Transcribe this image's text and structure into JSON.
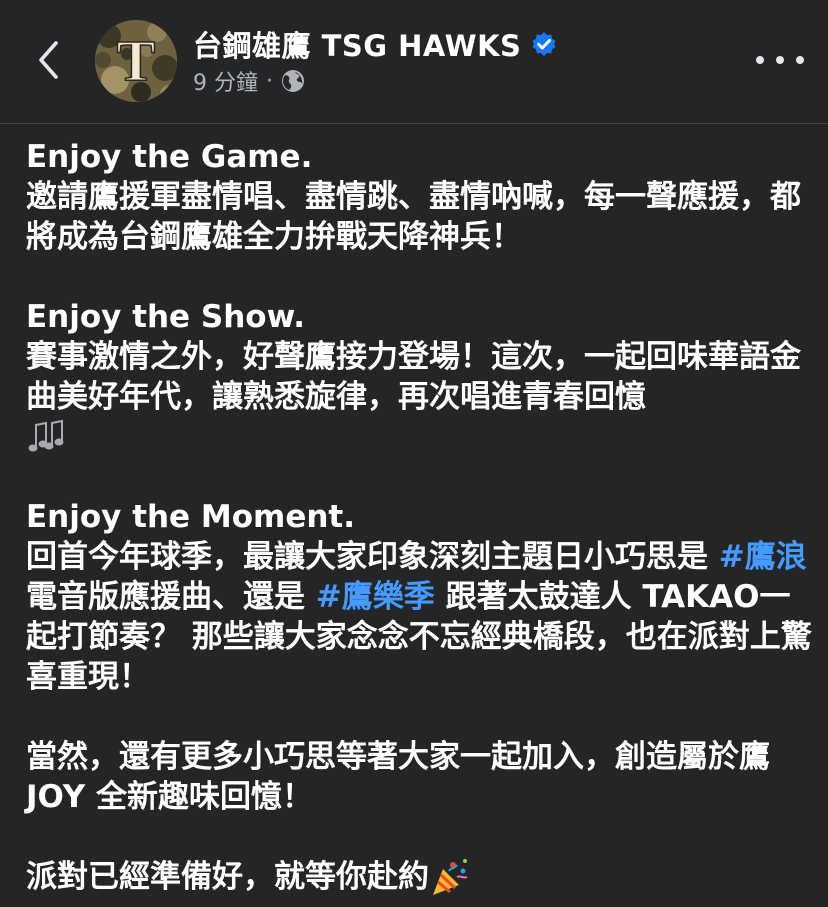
{
  "header": {
    "back_icon": "chevron-left-icon",
    "page_name": "台鋼雄鷹 TSG HAWKS",
    "verified_icon": "verified-badge-icon",
    "timestamp": "9 分鐘",
    "separator": "·",
    "audience_icon": "globe-icon",
    "more_icon": "more-horizontal-icon",
    "avatar_letter": "T"
  },
  "post": {
    "p1_title": "Enjoy the Game.",
    "p1_body": "邀請鷹援軍盡情唱、盡情跳、盡情吶喊，每一聲應援，都將成為台鋼鷹雄全力拚戰天降神兵！",
    "p2_title": "Enjoy the Show.",
    "p2_body": "賽事激情之外，好聲鷹接力登場！這次，一起回味華語金曲美好年代，讓熟悉旋律，再次唱進青春回憶",
    "p2_emoji": "musical-notes-icon",
    "p3_title": "Enjoy the Moment.",
    "p3_text_a": "回首今年球季，最讓大家印象深刻主題日小巧思是 ",
    "p3_hashtag_1": "#鷹浪",
    "p3_text_b": " 電音版應援曲、還是 ",
    "p3_hashtag_2": "#鷹樂季",
    "p3_text_c": " 跟著太鼓達人 TAKAO一起打節奏？ 那些讓大家念念不忘經典橋段，也在派對上驚喜重現！",
    "p4_body": "當然，還有更多小巧思等著大家一起加入，創造屬於鷹 JOY 全新趣味回憶！",
    "p5_body": "派對已經準備好，就等你赴約",
    "p5_emoji": "party-popper-icon"
  },
  "colors": {
    "background": "#242526",
    "text": "#ffffff",
    "secondary_text": "#b0b3b8",
    "hashtag": "#4599ff",
    "verified": "#1877f2"
  }
}
